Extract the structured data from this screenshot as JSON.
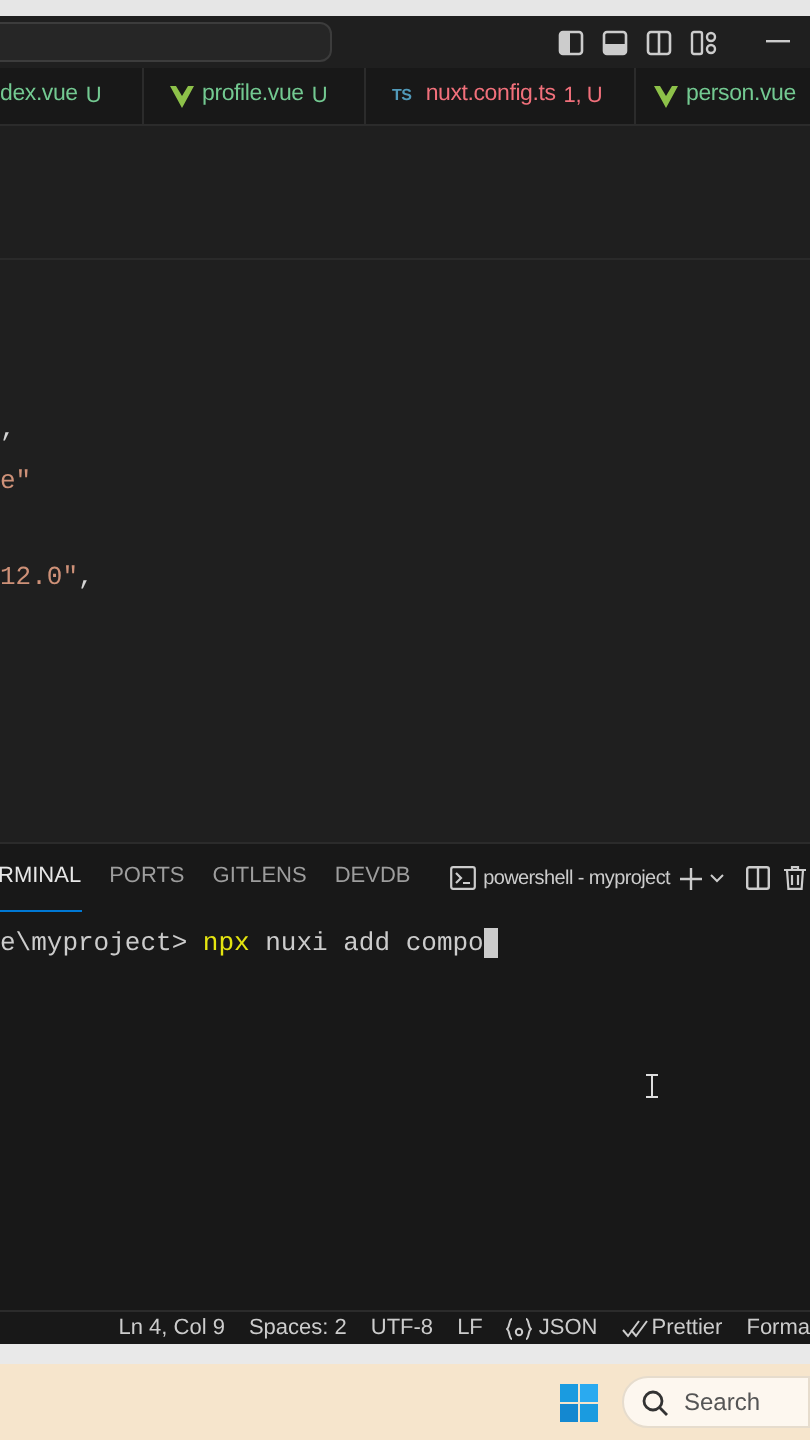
{
  "tabs": [
    {
      "label": "dex.vue",
      "status": "U",
      "kind": "plain",
      "has_errors": false
    },
    {
      "label": "profile.vue",
      "status": "U",
      "kind": "vue",
      "has_errors": false
    },
    {
      "label": "nuxt.config.ts",
      "status": "1, U",
      "kind": "ts",
      "icon_text": "TS",
      "has_errors": true
    },
    {
      "label": "person.vue",
      "kind": "vue",
      "has_errors": false
    }
  ],
  "editor": {
    "lines": [
      [
        {
          "text": ",",
          "kind": "punct"
        }
      ],
      [
        {
          "text": "e\"",
          "kind": "string"
        }
      ],
      [
        {
          "text": "12.0\"",
          "kind": "string"
        },
        {
          "text": ",",
          "kind": "punct"
        }
      ]
    ]
  },
  "panel": {
    "tabs": [
      {
        "label": "RMINAL",
        "selected": true
      },
      {
        "label": "PORTS",
        "selected": false
      },
      {
        "label": "GITLENS",
        "selected": false
      },
      {
        "label": "DEVDB",
        "selected": false
      }
    ],
    "terminal_name": "powershell - myproject",
    "terminal_line": [
      {
        "text": "e\\myproject> ",
        "kind": "plain"
      },
      {
        "text": "npx",
        "kind": "command"
      },
      {
        "text": " nuxi add compo",
        "kind": "plain"
      }
    ]
  },
  "status_bar": [
    {
      "text": "Ln 4, Col 9",
      "kind": "plain"
    },
    {
      "text": "Spaces: 2",
      "kind": "plain"
    },
    {
      "text": "UTF-8",
      "kind": "plain"
    },
    {
      "text": "LF",
      "kind": "plain"
    },
    {
      "text": "JSON",
      "kind": "language"
    },
    {
      "text": "Prettier",
      "kind": "formatter"
    },
    {
      "text": "Forma",
      "kind": "plain"
    }
  ],
  "taskbar": {
    "search_placeholder": "Search"
  }
}
